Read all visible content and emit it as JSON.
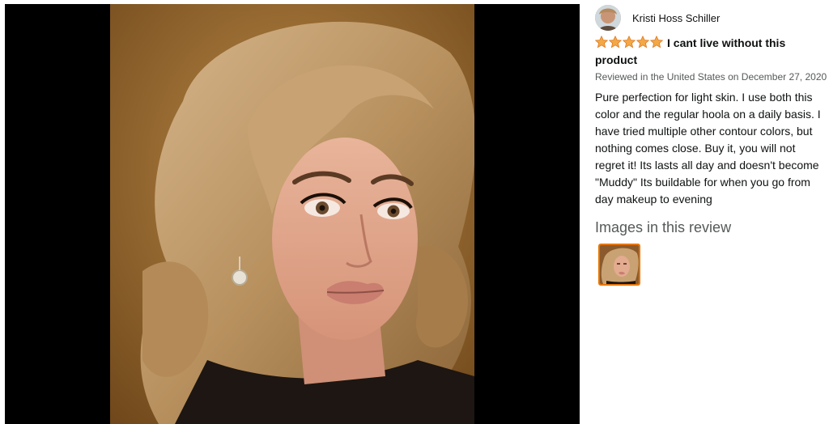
{
  "reviewer": {
    "name": "Kristi Hoss Schiller"
  },
  "review": {
    "rating": 5,
    "rating_max": 5,
    "title": "I cant live without this product",
    "meta": "Reviewed in the United States on December 27, 2020",
    "body": "Pure perfection for light skin. I use both this color and the regular hoola on a daily basis. I have tried multiple other contour colors, but nothing comes close. Buy it, you will not regret it! Its lasts all day and doesn't become \"Muddy\" Its buildable for when you go from day makeup to evening"
  },
  "images_section": {
    "heading": "Images in this review",
    "count": 1
  },
  "colors": {
    "star": "#f3a847",
    "thumb_border": "#e77600",
    "viewer_bg": "#000000"
  },
  "icons": {
    "star": "star-icon",
    "avatar": "avatar"
  }
}
